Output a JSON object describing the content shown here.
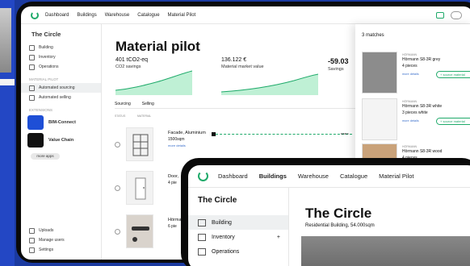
{
  "nav": {
    "items": [
      "Dashboard",
      "Buildings",
      "Warehouse",
      "Catalogue",
      "Material Pilot"
    ]
  },
  "sidebar": {
    "project": "The Circle",
    "items": [
      "Building",
      "Inventory",
      "Operations"
    ],
    "section_pilot": "MATERIAL PILOT",
    "pilot_items": [
      "Automated sourcing",
      "Automated selling"
    ],
    "section_ext": "EXTENSIONS",
    "extensions": [
      "BIM-Connect",
      "Value Chain"
    ],
    "more_apps": "more apps",
    "bottom": [
      "Uploads",
      "Manage users",
      "Settings"
    ]
  },
  "main": {
    "title": "Material pilot",
    "kpis": [
      {
        "value": "401 tCO2-eq",
        "label": "CO2 savings"
      },
      {
        "value": "136.122 €",
        "label": "Material market value"
      },
      {
        "value": "-59.03",
        "label": "Savings"
      }
    ],
    "tabs": [
      "Sourcing",
      "Selling"
    ],
    "columns": [
      "STATUS",
      "MATERIAL"
    ],
    "rows": [
      {
        "name": "Facade, Aluminium",
        "qty": "1500sqm",
        "more": "more details"
      },
      {
        "name": "Door, ",
        "qty": "4 pie"
      },
      {
        "name": "Hörma",
        "qty": "6 pie"
      }
    ],
    "pipe_label": "searc"
  },
  "matches": {
    "title": "3 matches",
    "items": [
      {
        "brand": "HÖRMANN",
        "name": "Hörmann S8-3R grey",
        "qty": "4 pieces",
        "link": "more details",
        "source": "+ source material"
      },
      {
        "brand": "HÖRMANN",
        "name": "Hörmann S8-3R white",
        "qty": "3 pieces white",
        "link": "more details",
        "source": "+ source material"
      },
      {
        "brand": "HÖRMANN",
        "name": "Hörmann S8-3R wood",
        "qty": "4 pieces"
      }
    ]
  },
  "front": {
    "nav": [
      "Dashboard",
      "Buildings",
      "Warehouse",
      "Catalogue",
      "Material Pilot"
    ],
    "project": "The Circle",
    "items": [
      "Building",
      "Inventory",
      "Operations"
    ],
    "plus": "+",
    "title": "The Circle",
    "subtitle": "Residential Building, 54.000sqm"
  },
  "colors": {
    "accent": "#1faa6a",
    "background": "#1b3aa0"
  }
}
